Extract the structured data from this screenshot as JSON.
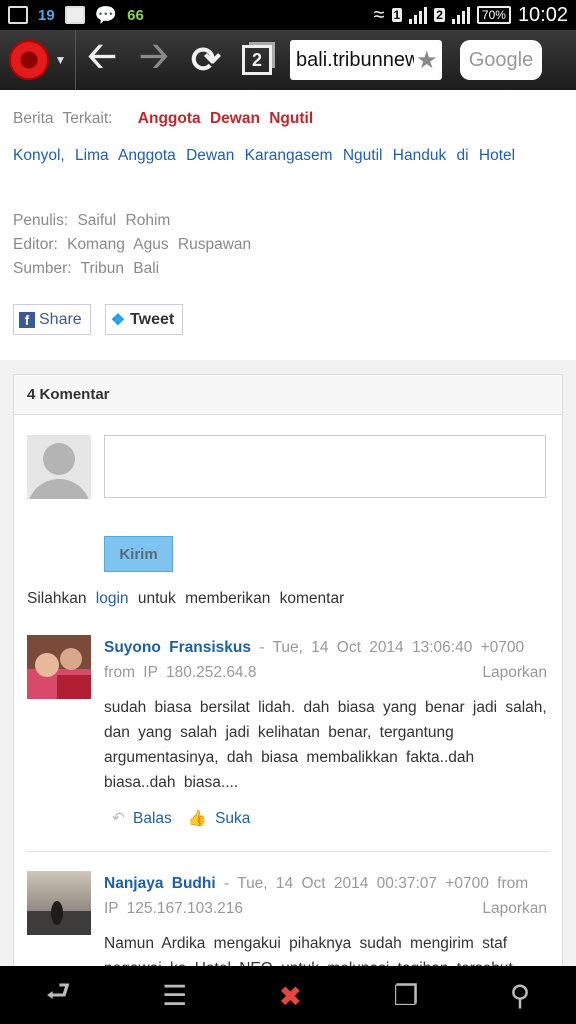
{
  "status_bar": {
    "left_number": "19",
    "notif_count": "66",
    "sim1": "1",
    "sim2": "2",
    "battery": "70%",
    "time": "10:02"
  },
  "toolbar": {
    "url": "bali.tribunnews.com",
    "tabs_count": "2",
    "search_placeholder": "Google"
  },
  "article": {
    "related_label": "Berita Terkait:",
    "related_link": "Anggota Dewan Ngutil",
    "related_title": "Konyol, Lima Anggota Dewan Karangasem Ngutil Handuk di Hotel",
    "penulis": "Penulis: Saiful Rohim",
    "editor": "Editor: Komang Agus Ruspawan",
    "sumber": "Sumber: Tribun Bali",
    "share_label": "Share",
    "tweet_label": "Tweet"
  },
  "comments": {
    "header": "4 Komentar",
    "submit_label": "Kirim",
    "login_prefix": "Silahkan",
    "login_link": "login",
    "login_suffix": "untuk memberikan komentar",
    "items": [
      {
        "name": "Suyono Fransiskus",
        "date": "- Tue, 14 Oct 2014 13:06:40 +0700",
        "ip": "from IP 180.252.64.8",
        "report": "Laporkan",
        "text": "sudah biasa bersilat lidah. dah biasa yang benar jadi salah, dan yang salah jadi kelihatan benar, tergantung argumentasinya, dah biasa membalikkan fakta..dah biasa..dah biasa....",
        "reply": "Balas",
        "like": "Suka"
      },
      {
        "name": "Nanjaya Budhi",
        "date": "- Tue, 14 Oct 2014 00:37:07 +0700 from",
        "ip": "IP 125.167.103.216",
        "report": "Laporkan",
        "text": "Namun Ardika mengakui pihaknya sudah mengirim staf pegawai ke Hotel NEO untuk melunasi tagihan tersebut"
      }
    ]
  },
  "colors": {
    "link_blue": "#1f5fa8",
    "related_red": "#c0272d",
    "kirim_bg": "#7fc4f0"
  }
}
